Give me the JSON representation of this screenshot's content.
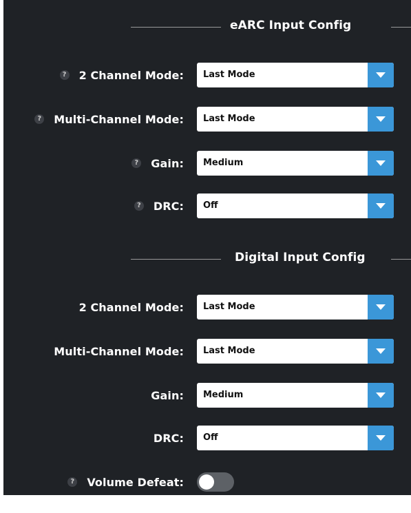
{
  "sections": [
    {
      "title": "eARC Input Config",
      "rows": [
        {
          "label": "2 Channel Mode:",
          "value": "Last Mode",
          "help": "?"
        },
        {
          "label": "Multi-Channel Mode:",
          "value": "Last Mode",
          "help": "?"
        },
        {
          "label": "Gain:",
          "value": "Medium",
          "help": "?"
        },
        {
          "label": "DRC:",
          "value": "Off",
          "help": "?"
        }
      ]
    },
    {
      "title": "Digital Input Config",
      "rows": [
        {
          "label": "2 Channel Mode:",
          "value": "Last Mode"
        },
        {
          "label": "Multi-Channel Mode:",
          "value": "Last Mode"
        },
        {
          "label": "Gain:",
          "value": "Medium"
        },
        {
          "label": "DRC:",
          "value": "Off"
        }
      ]
    }
  ],
  "volume_defeat": {
    "label": "Volume Defeat:",
    "help": "?",
    "enabled": false
  },
  "colors": {
    "panel_bg": "#1f2226",
    "accent": "#3b97d8",
    "toggle_off": "#5d6166"
  },
  "icons": {
    "help": "question-mark-circle",
    "dropdown": "triangle-down"
  }
}
